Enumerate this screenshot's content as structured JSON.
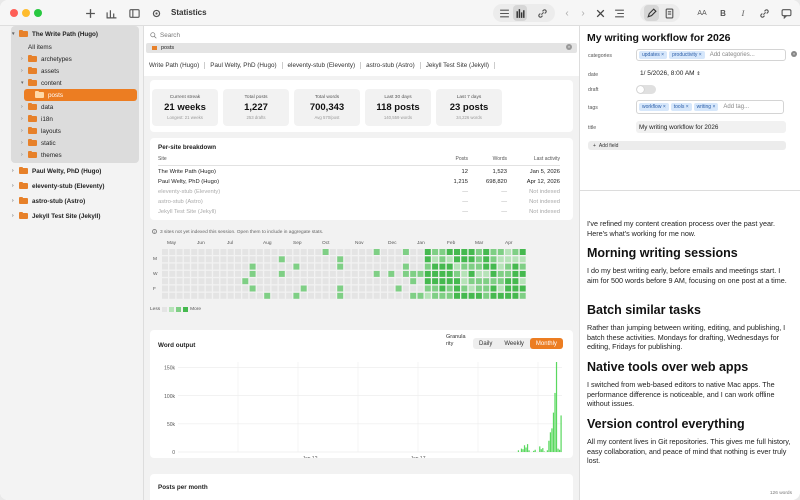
{
  "toolbar": {
    "title": "Statistics",
    "icons": [
      "plus-icon",
      "chart-icon",
      "sidebar-icon",
      "gear-icon",
      "list-icon",
      "stats-icon",
      "link-icon",
      "chevron-left-icon",
      "chevron-right-icon",
      "close-icon",
      "menu-icon",
      "pen-icon",
      "doc-icon",
      "font-size-icon",
      "bold-icon",
      "italic-icon",
      "link-icon",
      "comment-icon"
    ],
    "font_size_label": "AA",
    "bold_label": "B",
    "italic_label": "I"
  },
  "sidebar": {
    "items": [
      {
        "label": "The Write Path (Hugo)",
        "chev": "▾",
        "depth": 0,
        "folder": true,
        "bold": true,
        "y": 2
      },
      {
        "label": "All items",
        "chev": "",
        "depth": 1,
        "folder": false,
        "y": 15
      },
      {
        "label": "archetypes",
        "chev": "›",
        "depth": 1,
        "folder": true,
        "y": 27
      },
      {
        "label": "assets",
        "chev": "›",
        "depth": 1,
        "folder": true,
        "y": 39
      },
      {
        "label": "content",
        "chev": "▾",
        "depth": 1,
        "folder": true,
        "y": 51
      },
      {
        "label": "posts",
        "chev": "",
        "depth": 2,
        "folder": true,
        "selected": true,
        "y": 63
      },
      {
        "label": "data",
        "chev": "›",
        "depth": 1,
        "folder": true,
        "y": 75
      },
      {
        "label": "i18n",
        "chev": "›",
        "depth": 1,
        "folder": true,
        "y": 87
      },
      {
        "label": "layouts",
        "chev": "›",
        "depth": 1,
        "folder": true,
        "y": 99
      },
      {
        "label": "static",
        "chev": "›",
        "depth": 1,
        "folder": true,
        "y": 111
      },
      {
        "label": "themes",
        "chev": "›",
        "depth": 1,
        "folder": true,
        "y": 123
      }
    ],
    "sites": [
      {
        "label": "Paul Welty, PhD (Hugo)",
        "y": 139
      },
      {
        "label": "eleventy-stub (Eleventy)",
        "y": 154
      },
      {
        "label": "astro-stub (Astro)",
        "y": 169
      },
      {
        "label": "Jekyll Test Site (Jekyll)",
        "y": 184
      }
    ]
  },
  "center": {
    "search_placeholder": "Search",
    "tab_label": "posts",
    "site_tabs": [
      "Write Path (Hugo)",
      "Paul Welty, PhD (Hugo)",
      "eleventy-stub (Eleventy)",
      "astro-stub (Astro)",
      "Jekyll Test Site (Jekyll)"
    ],
    "stats": [
      {
        "label": "Current streak",
        "value": "21 weeks",
        "sub": "Longest: 21 weeks"
      },
      {
        "label": "Total posts",
        "value": "1,227",
        "sub": "253 drafts"
      },
      {
        "label": "Total words",
        "value": "700,343",
        "sub": "Avg 570/post"
      },
      {
        "label": "Last 30 days",
        "value": "118 posts",
        "sub": "140,559 words"
      },
      {
        "label": "Last 7 days",
        "value": "23 posts",
        "sub": "34,226 words"
      }
    ],
    "breakdown": {
      "title": "Per-site breakdown",
      "headers": {
        "site": "Site",
        "posts": "Posts",
        "words": "Words",
        "last": "Last activity"
      },
      "rows": [
        {
          "site": "The Write Path (Hugo)",
          "posts": "12",
          "words": "1,523",
          "last": "Jan 5, 2026",
          "dim": false
        },
        {
          "site": "Paul Welty, PhD (Hugo)",
          "posts": "1,215",
          "words": "698,820",
          "last": "Apr 12, 2026",
          "dim": false
        },
        {
          "site": "eleventy-stub (Eleventy)",
          "posts": "—",
          "words": "—",
          "last": "Not indexed",
          "dim": true
        },
        {
          "site": "astro-stub (Astro)",
          "posts": "—",
          "words": "—",
          "last": "Not indexed",
          "dim": true
        },
        {
          "site": "Jekyll Test Site (Jekyll)",
          "posts": "—",
          "words": "—",
          "last": "Not indexed",
          "dim": true
        }
      ],
      "note": "3 sites not yet indexed this session. Open them to include in aggregate stats."
    },
    "heatmap": {
      "months": [
        "May",
        "Jun",
        "Jul",
        "Aug",
        "Sep",
        "Oct",
        "Nov",
        "Dec",
        "Jan",
        "Feb",
        "Mar",
        "Apr"
      ],
      "day_labels": [
        "M",
        "W",
        "F"
      ],
      "legend_less": "Less",
      "legend_more": "More"
    },
    "word_output": {
      "title": "Word output",
      "granularity_label": "Granularity",
      "options": [
        "Daily",
        "Weekly",
        "Monthly"
      ],
      "selected": "Monthly"
    },
    "posts_per_month_title": "Posts per month"
  },
  "chart_data": {
    "type": "bar",
    "title": "Word output",
    "y_ticks": [
      "150k",
      "100k",
      "50k",
      "0"
    ],
    "x_ticks": [
      "Jan 12",
      "Jan 17"
    ],
    "ylim": [
      0,
      160000
    ],
    "values": [
      0,
      0,
      0,
      0,
      0,
      0,
      0,
      0,
      0,
      0,
      0,
      0,
      0,
      0,
      0,
      0,
      0,
      0,
      0,
      0,
      0,
      0,
      0,
      0,
      0,
      0,
      0,
      0,
      0,
      0,
      0,
      0,
      0,
      0,
      0,
      0,
      0,
      0,
      0,
      0,
      0,
      0,
      0,
      0,
      0,
      0,
      0,
      0,
      0,
      0,
      0,
      0,
      0,
      0,
      0,
      0,
      0,
      0,
      0,
      0,
      0,
      0,
      0,
      0,
      0,
      0,
      0,
      0,
      0,
      0,
      0,
      0,
      0,
      0,
      0,
      0,
      0,
      0,
      0,
      0,
      0,
      0,
      0,
      0,
      0,
      0,
      0,
      0,
      0,
      0,
      0,
      0,
      0,
      0,
      0,
      0,
      0,
      0,
      0,
      0,
      0,
      0,
      0,
      0,
      0,
      0,
      0,
      0,
      0,
      0,
      0,
      0,
      0,
      0,
      0,
      0,
      0,
      0,
      0,
      0,
      0,
      0,
      0,
      0,
      0,
      0,
      0,
      0,
      0,
      0,
      0,
      0,
      0,
      0,
      0,
      0,
      0,
      0,
      0,
      0,
      0,
      0,
      0,
      0,
      0,
      0,
      0,
      0,
      0,
      0,
      0,
      0,
      0,
      0,
      0,
      0,
      0,
      0,
      0,
      0,
      0,
      0,
      0,
      0,
      0,
      0,
      0,
      0,
      0,
      0,
      0,
      0,
      0,
      0,
      0,
      0,
      0,
      0,
      0,
      0,
      0,
      0,
      0,
      0,
      0,
      0,
      0,
      0,
      0,
      0,
      0,
      0,
      0,
      0,
      0,
      0,
      0,
      0,
      0,
      0,
      0,
      0,
      0,
      0,
      0,
      0,
      0,
      0,
      0,
      0,
      0,
      0,
      0,
      0,
      0,
      0,
      0,
      0,
      0,
      0,
      0,
      0,
      0,
      3000,
      0,
      6000,
      5000,
      12000,
      8000,
      14000,
      3000,
      0,
      0,
      2000,
      4000,
      0,
      0,
      10000,
      5000,
      7000,
      1000,
      0,
      3000,
      20000,
      35000,
      42000,
      70000,
      105000,
      160000,
      6000,
      4000,
      65000
    ]
  },
  "inspector": {
    "title": "My writing workflow for 2026",
    "categories_label": "categories",
    "categories": [
      "updates",
      "productivity"
    ],
    "categories_placeholder": "Add categories...",
    "date_label": "date",
    "date_value": "1/  5/2026,  8:00 AM",
    "draft_label": "draft",
    "tags_label": "tags",
    "tags": [
      "workflow",
      "tools",
      "writing"
    ],
    "tags_placeholder": "Add tag...",
    "title_label": "title",
    "title_value": "My writing workflow for 2026",
    "add_field_label": "Add field"
  },
  "document": {
    "intro": "I've refined my content creation process over the past year. Here's what's working for me now.",
    "sections": [
      {
        "heading": "Morning writing sessions",
        "body": "I do my best writing early, before emails and meetings start. I aim for 500 words before 9 AM, focusing on one post at a time."
      },
      {
        "heading": "Batch similar tasks",
        "body": "Rather than jumping between writing, editing, and publishing, I batch these activities. Mondays for drafting, Wednesdays for editing, Fridays for publishing."
      },
      {
        "heading": "Native tools over web apps",
        "body": "I switched from web-based editors to native Mac apps. The performance difference is noticeable, and I can work offline without issues."
      },
      {
        "heading": "Version control everything",
        "body": "All my content lives in Git repositories. This gives me full history, easy collaboration, and peace of mind that nothing is ever truly lost."
      }
    ],
    "word_count": "126 words"
  }
}
